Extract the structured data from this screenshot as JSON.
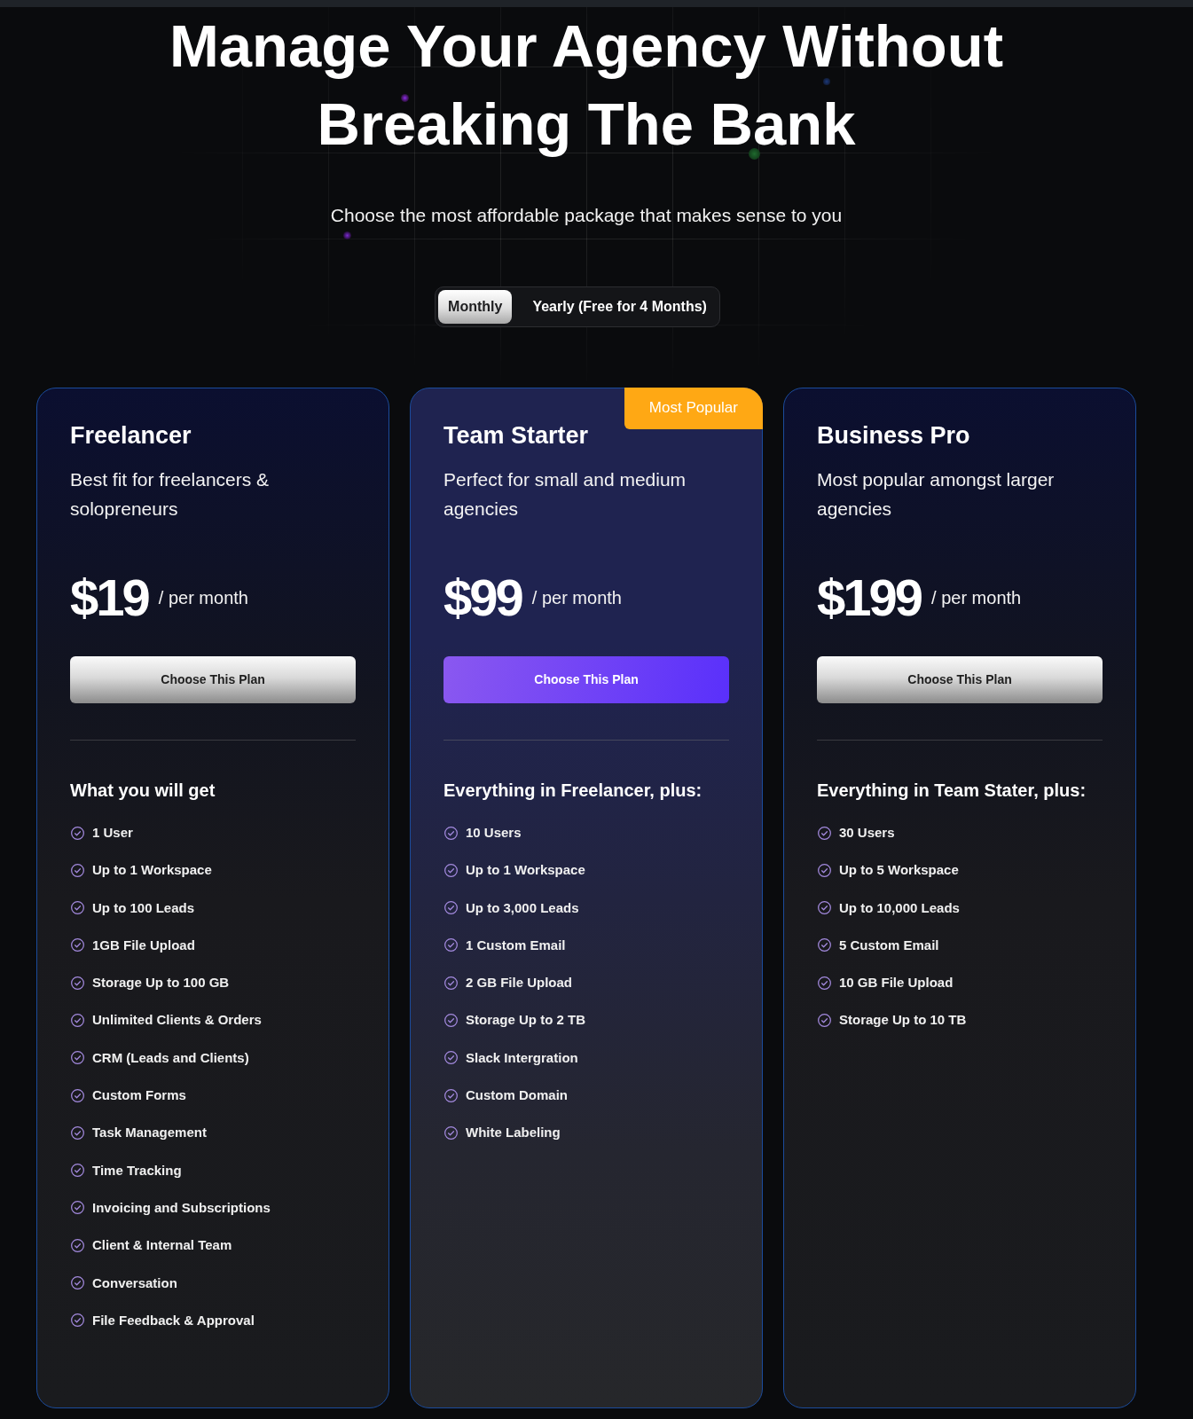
{
  "hero": {
    "title": "Manage Your Agency Without Breaking The Bank",
    "subtitle": "Choose the most affordable package that makes sense to you"
  },
  "billing_toggle": [
    {
      "label": "Monthly",
      "selected": true
    },
    {
      "label": "Yearly (Free for 4 Months)",
      "selected": false
    }
  ],
  "plans": [
    {
      "name": "Freelancer",
      "description": "Best fit for freelancers & solopreneurs",
      "price": "$19",
      "period": "/ per month",
      "button": "Choose This Plan",
      "highlighted": false,
      "features_heading": "What you will get",
      "features": [
        "1 User",
        "Up to 1 Workspace",
        "Up to 100 Leads",
        "1GB File Upload",
        "Storage Up to 100 GB",
        "Unlimited Clients & Orders",
        "CRM (Leads and Clients)",
        "Custom Forms",
        "Task Management",
        "Time Tracking",
        "Invoicing and Subscriptions",
        "Client & Internal Team",
        "Conversation",
        "File Feedback & Approval"
      ]
    },
    {
      "name": "Team Starter",
      "badge": "Most Popular",
      "description": "Perfect for small and medium agencies",
      "price": "$99",
      "period": "/ per month",
      "button": "Choose This Plan",
      "highlighted": true,
      "features_heading": "Everything in Freelancer, plus:",
      "features": [
        "10 Users",
        "Up to 1 Workspace",
        "Up to 3,000 Leads",
        "1 Custom Email",
        "2 GB File Upload",
        "Storage Up to 2 TB",
        "Slack Intergration",
        "Custom Domain",
        "White Labeling"
      ]
    },
    {
      "name": "Business Pro",
      "description": "Most popular amongst larger agencies",
      "price": "$199",
      "period": "/ per month",
      "button": "Choose This Plan",
      "highlighted": false,
      "features_heading": "Everything in Team Stater, plus:",
      "features": [
        "30 Users",
        "Up to 5 Workspace",
        "Up to 10,000 Leads",
        "5 Custom Email",
        "10 GB File Upload",
        "Storage Up to 10 TB"
      ]
    }
  ]
}
